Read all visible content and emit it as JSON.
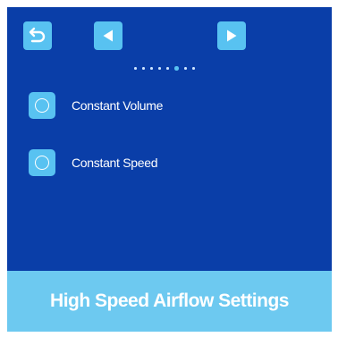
{
  "screen": {
    "background_color": "#0a3ea8",
    "accent_color": "#58c2f1",
    "footer_color": "#6dc9f0"
  },
  "nav": {
    "back_icon": "return-arrow-icon",
    "prev_icon": "triangle-left-icon",
    "next_icon": "triangle-right-icon",
    "page_count": 8,
    "current_page": 6
  },
  "options": [
    {
      "label": "Constant Volume",
      "selected": false,
      "icon": "radio-unselected-icon"
    },
    {
      "label": "Constant Speed",
      "selected": false,
      "icon": "radio-unselected-icon"
    }
  ],
  "footer": {
    "title": "High Speed Airflow Settings"
  }
}
